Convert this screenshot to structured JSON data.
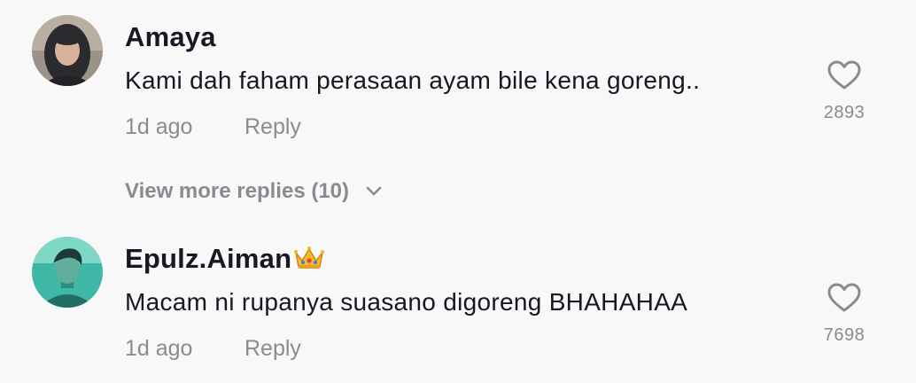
{
  "comments": [
    {
      "username": "Amaya",
      "text": "Kami dah faham perasaan ayam bile kena goreng..",
      "time": "1d ago",
      "reply_label": "Reply",
      "like_count": "2893"
    },
    {
      "username": "Epulz.Aiman",
      "badge": "crown-emoji",
      "text": "Macam ni rupanya suasano digoreng BHAHAHAA",
      "time": "1d ago",
      "reply_label": "Reply",
      "like_count": "7698"
    }
  ],
  "view_more_label": "View more replies (10)",
  "colors": {
    "background": "#f8f8f8",
    "primary_text": "#161823",
    "secondary_text": "#8a8b91"
  }
}
